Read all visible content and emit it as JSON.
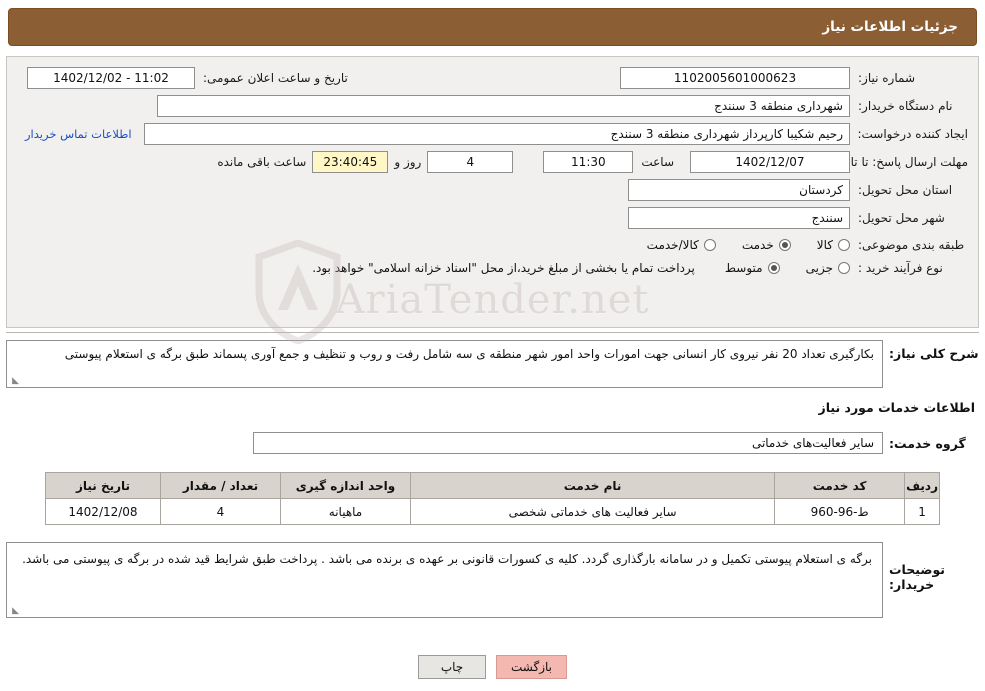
{
  "header": {
    "title": "جزئیات اطلاعات نیاز"
  },
  "info": {
    "need_number_label": "شماره نیاز:",
    "need_number_value": "1102005601000623",
    "announce_date_label": "تاریخ و ساعت اعلان عمومی:",
    "announce_date_value": "11:02 - 1402/12/02",
    "buyer_org_label": "نام دستگاه خریدار:",
    "buyer_org_value": "شهرداری منطقه 3 سنندج",
    "creator_label": "ایجاد کننده درخواست:",
    "creator_value": "رحیم شکیبا کارپرداز شهرداری منطقه 3 سنندج",
    "contact_link": "اطلاعات تماس خریدار",
    "deadline_label": "مهلت ارسال پاسخ: تا تاریخ:",
    "deadline_date": "1402/12/07",
    "deadline_hour_label": "ساعت",
    "deadline_hour": "11:30",
    "remaining_days": "4",
    "remaining_days_label": "روز و",
    "remaining_time": "23:40:45",
    "remaining_suffix": "ساعت باقی مانده",
    "province_label": "استان محل تحویل:",
    "province_value": "کردستان",
    "city_label": "شهر محل تحویل:",
    "city_value": "سنندج",
    "category_label": "طبقه بندی موضوعی:",
    "category_options": [
      {
        "label": "کالا",
        "selected": false
      },
      {
        "label": "خدمت",
        "selected": true
      },
      {
        "label": "کالا/خدمت",
        "selected": false
      }
    ],
    "process_label": "نوع فرآیند خرید :",
    "process_options": [
      {
        "label": "جزیی",
        "selected": false
      },
      {
        "label": "متوسط",
        "selected": true
      }
    ],
    "process_note": "پرداخت تمام یا بخشی از مبلغ خرید،از محل \"اسناد خزانه اسلامی\" خواهد بود."
  },
  "need_desc": {
    "label": "شرح کلی نیاز:",
    "value": "بکارگیری تعداد 20 نفر نیروی کار انسانی جهت امورات  واحد امور شهر منطقه ی سه شامل رفت و روب و تنظیف و جمع آوری پسماند طبق برگه ی استعلام پیوستی"
  },
  "services_section": {
    "title": "اطلاعات خدمات مورد نیاز",
    "group_label": "گروه خدمت:",
    "group_value": "سایر فعالیت‌های خدماتی"
  },
  "table": {
    "headers": [
      "ردیف",
      "کد خدمت",
      "نام خدمت",
      "واحد اندازه گیری",
      "تعداد / مقدار",
      "تاریخ نیاز"
    ],
    "rows": [
      {
        "row": "1",
        "code": "ط-96-960",
        "name": "سایر فعالیت های خدماتی شخصی",
        "unit": "ماهیانه",
        "qty": "4",
        "date": "1402/12/08"
      }
    ]
  },
  "notes": {
    "label": "توضیحات خریدار:",
    "value": "برگه ی استعلام پیوستی تکمیل و در سامانه بارگذاری گردد. کلیه ی کسورات قانونی بر عهده ی برنده می باشد . پرداخت طبق شرایط قید شده در برگه ی پیوستی می باشد."
  },
  "footer": {
    "print_label": "چاپ",
    "back_label": "بازگشت"
  },
  "watermark": {
    "text": "AriaTender.net"
  }
}
